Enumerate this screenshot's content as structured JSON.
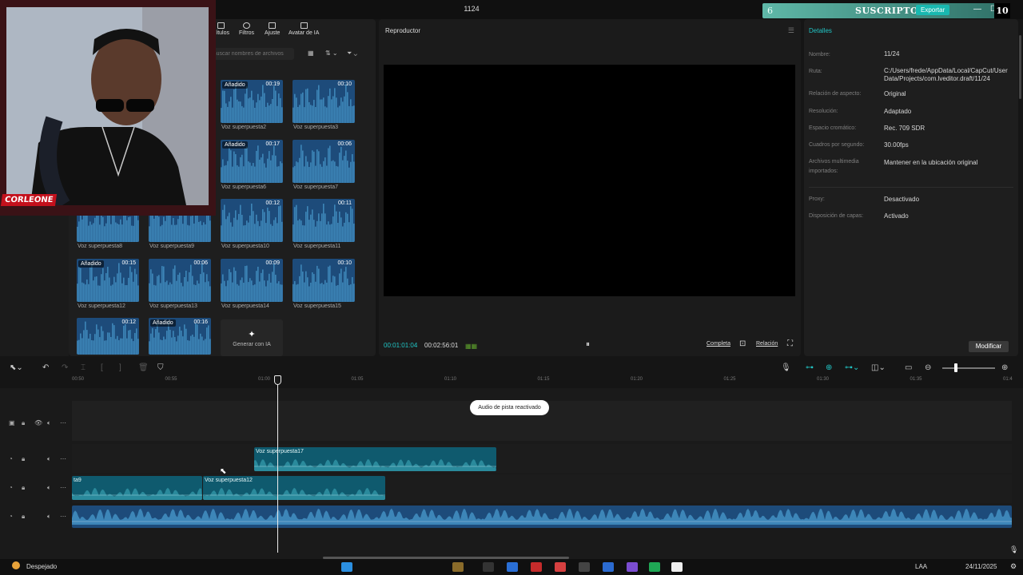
{
  "window": {
    "title": "1124"
  },
  "overlay": {
    "subscribers_left": "6",
    "subscribers_label": "SUSCRIPTORES",
    "export_label": "Exportar",
    "subscribers_count": "10",
    "webcam_logo": "CORLEONE"
  },
  "media_toolbar": {
    "items": [
      {
        "label": "Títulos"
      },
      {
        "label": "Filtros"
      },
      {
        "label": "Ajuste"
      },
      {
        "label": "Avatar de IA"
      }
    ],
    "search_placeholder": "Buscar nombres de archivos"
  },
  "media": {
    "items": [
      {
        "label": "Voz superpuesta2",
        "duration": "00:19",
        "added": "Añadido"
      },
      {
        "label": "Voz superpuesta3",
        "duration": "00:10",
        "added": ""
      },
      {
        "label": "Voz superpuesta6",
        "duration": "00:17",
        "added": "Añadido"
      },
      {
        "label": "Voz superpuesta7",
        "duration": "00:06",
        "added": ""
      },
      {
        "label": "Voz superpuesta8",
        "duration": "",
        "added": ""
      },
      {
        "label": "Voz superpuesta9",
        "duration": "",
        "added": ""
      },
      {
        "label": "Voz superpuesta10",
        "duration": "00:12",
        "added": ""
      },
      {
        "label": "Voz superpuesta11",
        "duration": "00:11",
        "added": ""
      },
      {
        "label": "Voz superpuesta12",
        "duration": "00:15",
        "added": "Añadido"
      },
      {
        "label": "Voz superpuesta13",
        "duration": "00:06",
        "added": ""
      },
      {
        "label": "Voz superpuesta14",
        "duration": "00:09",
        "added": ""
      },
      {
        "label": "Voz superpuesta15",
        "duration": "00:10",
        "added": ""
      },
      {
        "label": "",
        "duration": "00:12",
        "added": ""
      },
      {
        "label": "",
        "duration": "00:16",
        "added": "Añadido"
      }
    ],
    "generate_label": "Generar con IA"
  },
  "player": {
    "title": "Reproductor",
    "current_time": "00:01:01:04",
    "total_time": "00:02:56:01",
    "btn_full": "Completa",
    "btn_ratio": "Relación"
  },
  "details": {
    "title": "Detalles",
    "rows": [
      {
        "label": "Nombre:",
        "value": "11/24"
      },
      {
        "label": "Ruta:",
        "value": "C:/Users/frede/AppData/Local/CapCut/User Data/Projects/com.lveditor.draft/11/24"
      },
      {
        "label": "Relación de aspecto:",
        "value": "Original"
      },
      {
        "label": "Resolución:",
        "value": "Adaptado"
      },
      {
        "label": "Espacio cromático:",
        "value": "Rec. 709 SDR"
      },
      {
        "label": "Cuadros por segundo:",
        "value": "30.00fps"
      },
      {
        "label": "Archivos multimedia importados:",
        "value": "Mantener en la ubicación original"
      },
      {
        "label": "Proxy:",
        "value": "Desactivado"
      },
      {
        "label": "Disposición de capas:",
        "value": "Activado"
      }
    ],
    "modify_label": "Modificar"
  },
  "timeline": {
    "ruler": [
      "00:50",
      "00:55",
      "01:00",
      "01:05",
      "01:10",
      "01:15",
      "01:20",
      "01:25",
      "01:30",
      "01:35",
      "01:4"
    ],
    "toast": "Audio de pista reactivado",
    "clips": {
      "c17": "Voz superpuesta17",
      "c9": "ta9",
      "c12": "Voz superpuesta12"
    }
  },
  "taskbar": {
    "weather": "Despejado",
    "lang": "LAA",
    "date": "24/11/2025"
  },
  "colors": {
    "accent": "#21c5c5",
    "clip": "#0f5a6e",
    "audio": "#1d4b7a"
  }
}
